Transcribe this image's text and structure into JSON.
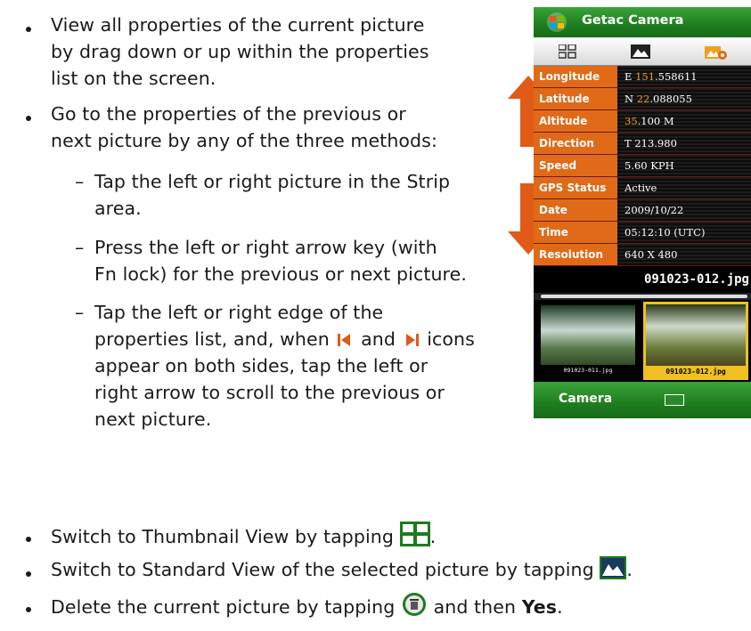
{
  "document": {
    "bullet1_line1": "View all properties of the current picture",
    "bullet1_line2": "by drag down or up within the properties",
    "bullet1_line3": "list on the screen.",
    "bullet2_line1": "Go to the properties of the previous or",
    "bullet2_line2": "next picture by any of the three methods:",
    "sub1_line1": "Tap the left or right picture in the Strip",
    "sub1_line2": "area.",
    "sub2_line1": "Press the left or right arrow key (with",
    "sub2_line2": "Fn lock) for the previous or next picture.",
    "sub3_line1": "Tap the left or right edge of the",
    "sub3_line2_a": "properties list, and, when",
    "sub3_line2_b": "and",
    "sub3_line2_c": "icons",
    "sub3_line3": "appear on both sides, tap the left or",
    "sub3_line4": "right arrow to scroll to the previous or",
    "sub3_line5": "next picture.",
    "dash": "–",
    "bullet3": "Switch to Thumbnail View by tapping",
    "bullet4": "Switch to Standard View of the selected picture by tapping",
    "bullet5_a": "Delete the current picture by tapping",
    "bullet5_b": "and then",
    "bullet5_bold": "Yes",
    "bullet5_end": "."
  },
  "phone": {
    "title": "Getac Camera",
    "tabs": [
      "thumbnail-view-icon",
      "standard-view-icon",
      "properties-view-icon"
    ],
    "properties": [
      {
        "key": "Longitude",
        "prefix": "E ",
        "highlight": "151",
        "rest": ".558611"
      },
      {
        "key": "Latitude",
        "prefix": "N ",
        "highlight": "22",
        "rest": ".088055"
      },
      {
        "key": "Altitude",
        "prefix": " ",
        "highlight": "35",
        "rest": ".100 M"
      },
      {
        "key": "Direction",
        "prefix": "T 213.980",
        "highlight": "",
        "rest": ""
      },
      {
        "key": "Speed",
        "prefix": "5.60 KPH",
        "highlight": "",
        "rest": ""
      },
      {
        "key": "GPS Status",
        "prefix": "Active",
        "highlight": "",
        "rest": ""
      },
      {
        "key": "Date",
        "prefix": "2009/10/22",
        "highlight": "",
        "rest": ""
      },
      {
        "key": "Time",
        "prefix": "05:12:10 (UTC)",
        "highlight": "",
        "rest": ""
      },
      {
        "key": "Resolution",
        "prefix": "640 X 480",
        "highlight": "",
        "rest": ""
      }
    ],
    "filename": "091023-012.jpg",
    "strip": [
      {
        "caption": "091023-011.jpg",
        "selected": false
      },
      {
        "caption": "091023-012.jpg",
        "selected": true
      }
    ],
    "bottom_left": "Camera"
  },
  "colors": {
    "accent_orange": "#e06a18",
    "arrow_orange": "#e05a18",
    "title_green": "#1f7d1f",
    "selection_yellow": "#f0c020"
  }
}
